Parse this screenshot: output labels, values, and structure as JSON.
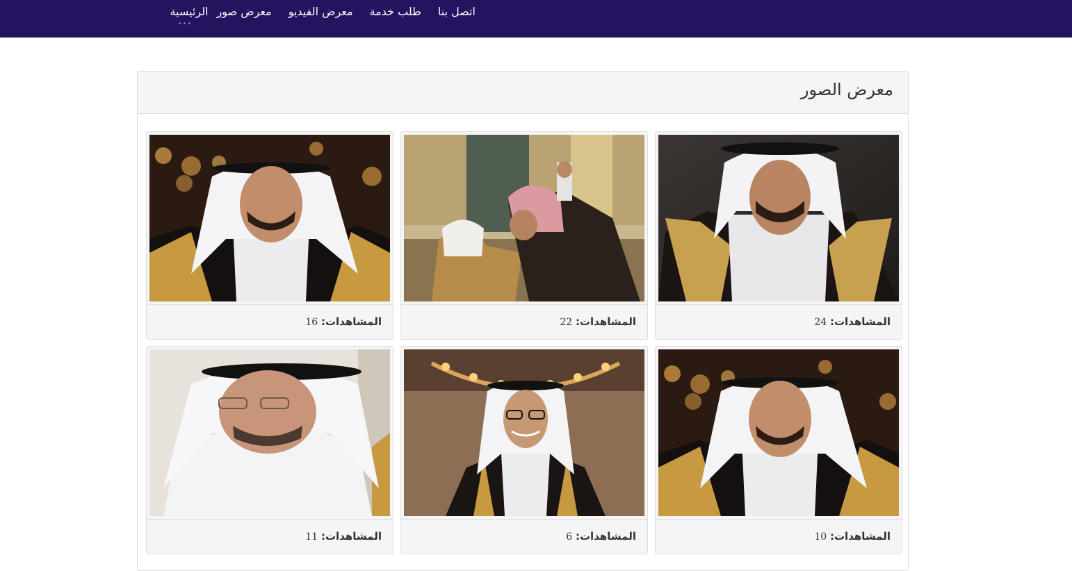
{
  "nav": {
    "items": [
      {
        "label": "الرئيسية",
        "active": true
      },
      {
        "label": "معرض صور",
        "active": false
      },
      {
        "label": "معرض الفيديو",
        "active": false
      },
      {
        "label": "طلب خدمة",
        "active": false
      },
      {
        "label": "اتصل بنا",
        "active": false
      }
    ],
    "active_indicator": "•••"
  },
  "colors": {
    "navbar": "#24135f",
    "panel_heading": "#f5f5f5",
    "border": "#dddddd"
  },
  "panel": {
    "title": "معرض الصور"
  },
  "gallery": {
    "views_label": "المشاهدات:",
    "items": [
      {
        "views": "24",
        "image": "portrait-man-gold-bisht-icon"
      },
      {
        "views": "22",
        "image": "man-kissing-elder-hand-photo-icon"
      },
      {
        "views": "16",
        "image": "portrait-man-smiling-bokeh-icon"
      },
      {
        "views": "10",
        "image": "portrait-man-smiling-bokeh-icon"
      },
      {
        "views": "6",
        "image": "man-glasses-chandelier-photo-icon"
      },
      {
        "views": "11",
        "image": "portrait-elder-man-glasses-icon"
      }
    ]
  }
}
